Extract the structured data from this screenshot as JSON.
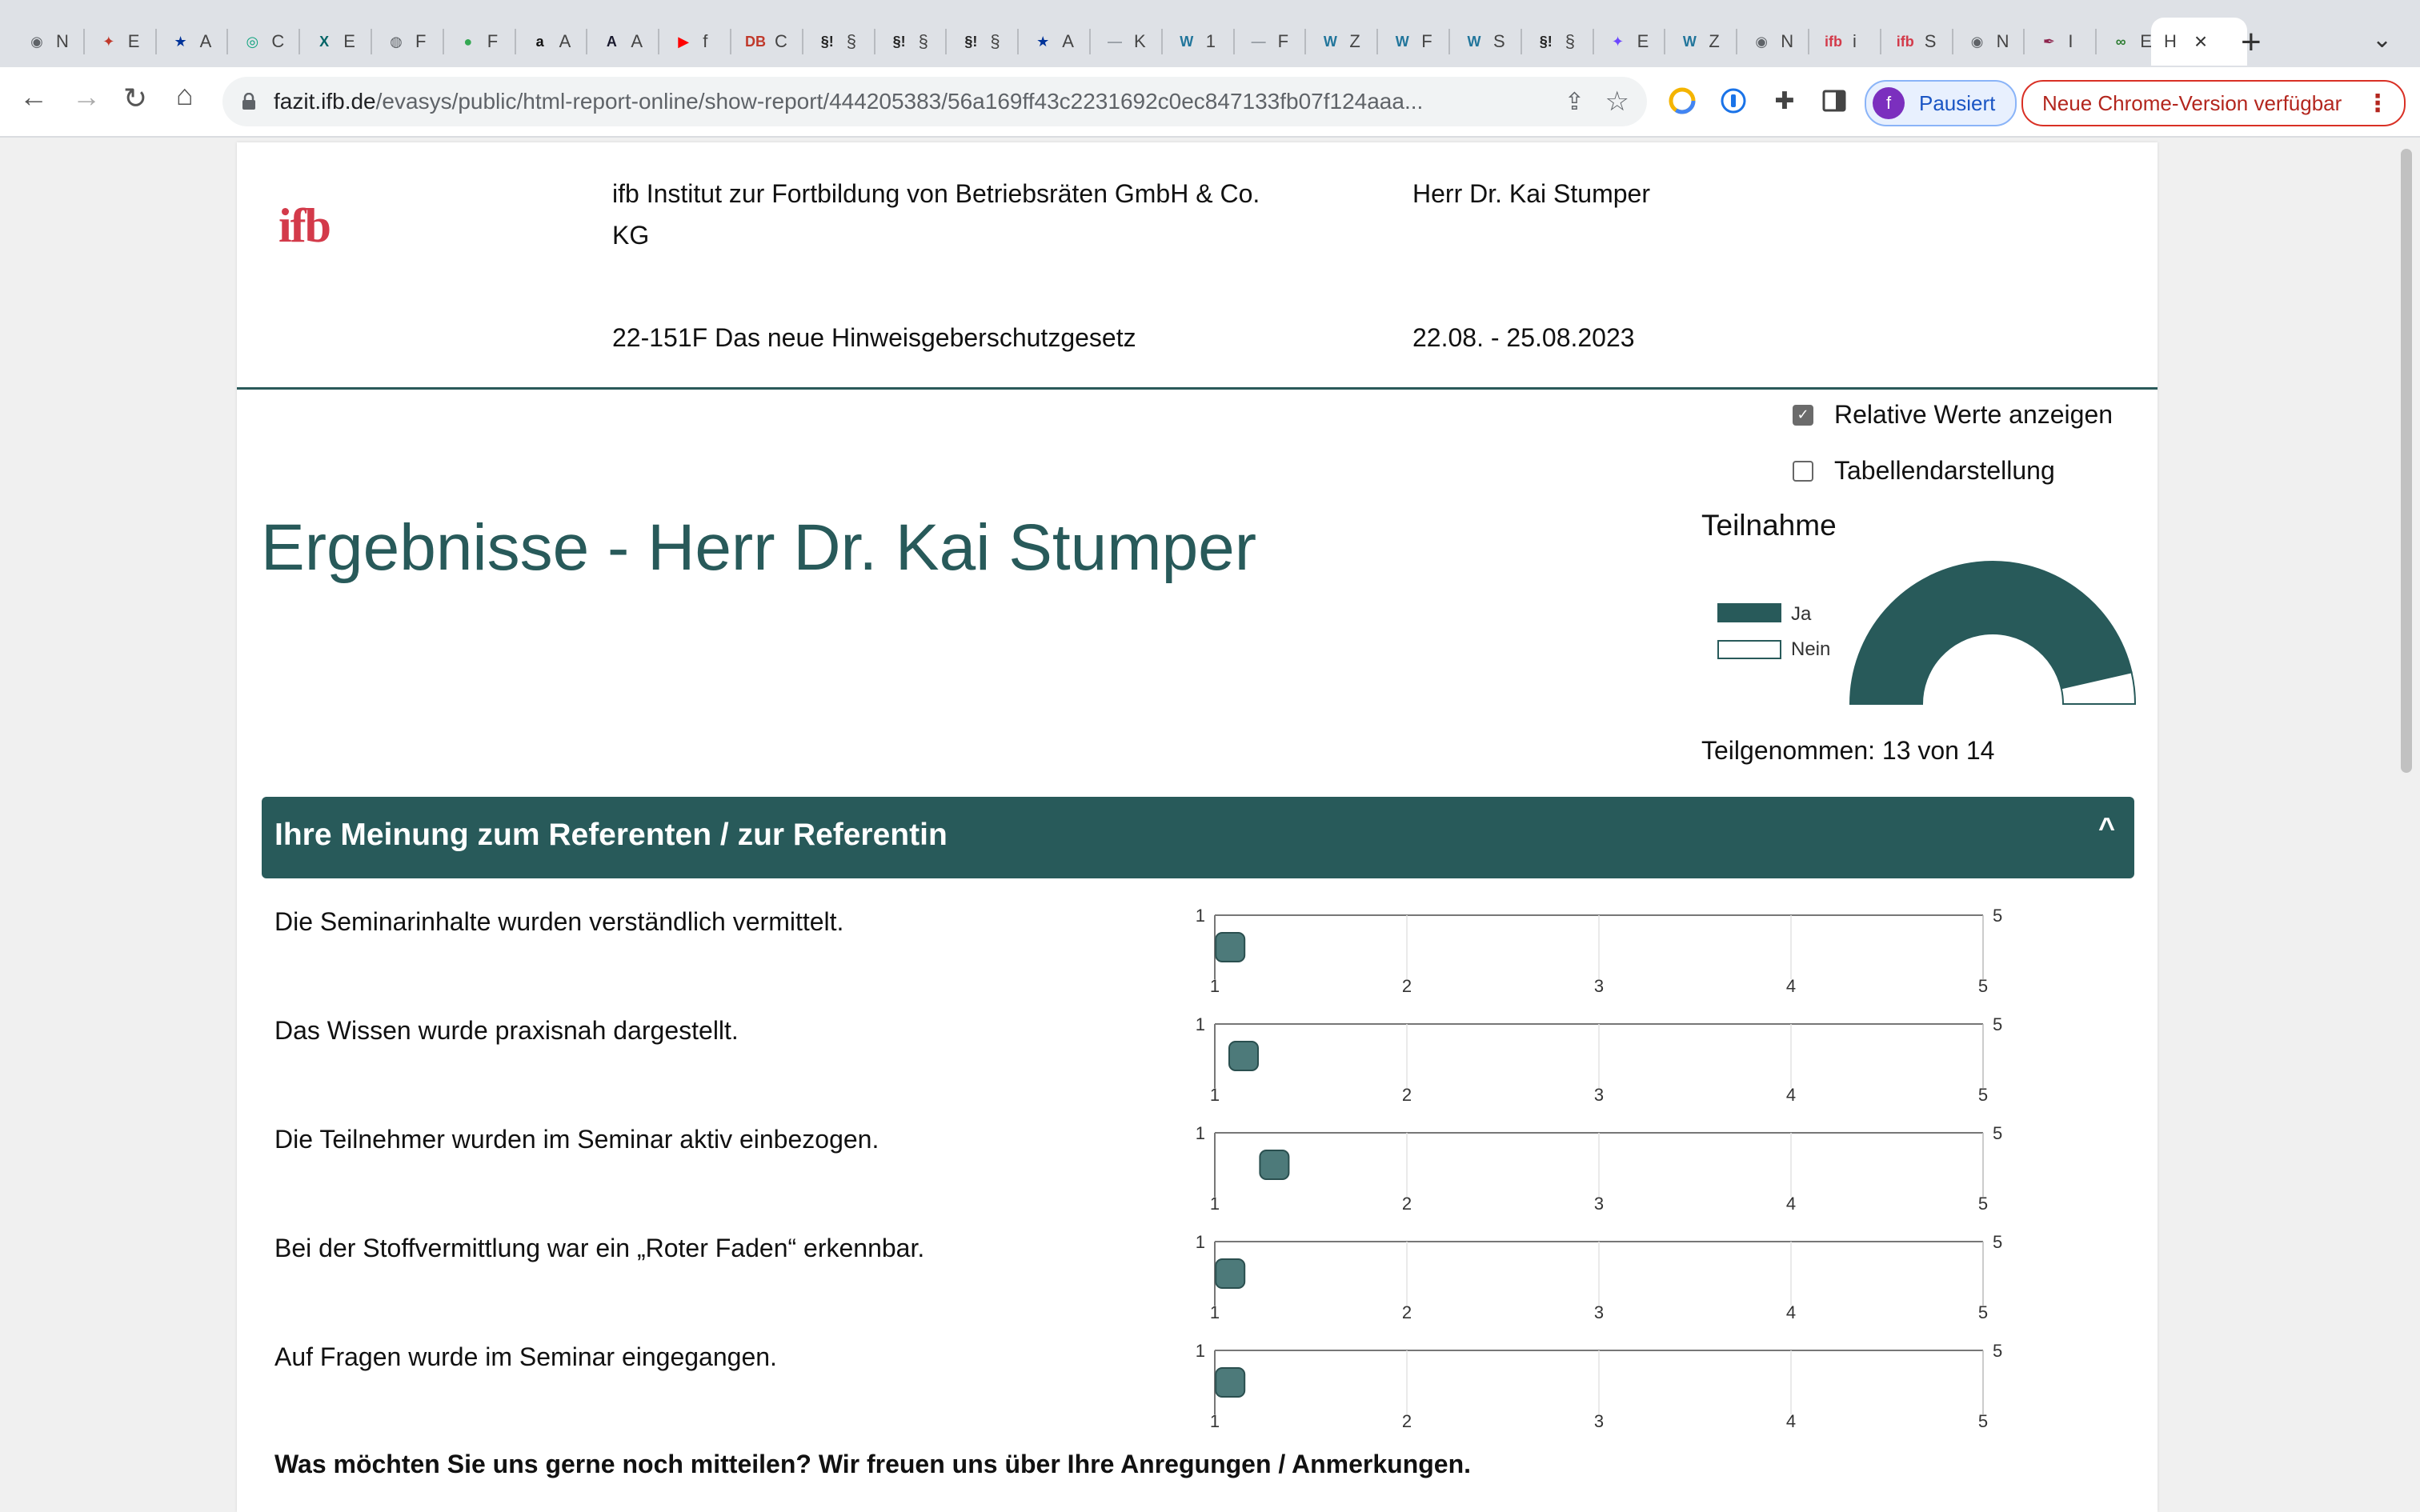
{
  "browser": {
    "tabs": [
      {
        "icon": "chrome-icon",
        "color": "#5f6368",
        "glyph": "◉",
        "label": "N"
      },
      {
        "icon": "bird-icon",
        "color": "#c0392b",
        "glyph": "✦",
        "label": "E"
      },
      {
        "icon": "eu-flag-icon",
        "color": "#003399",
        "glyph": "★",
        "label": "A"
      },
      {
        "icon": "openai-icon",
        "color": "#10a37f",
        "glyph": "◎",
        "label": "C"
      },
      {
        "icon": "xing-icon",
        "color": "#026466",
        "glyph": "X",
        "label": "E"
      },
      {
        "icon": "globe-icon",
        "color": "#5f6368",
        "glyph": "◍",
        "label": "F"
      },
      {
        "icon": "maps-pin-icon",
        "color": "#34a853",
        "glyph": "●",
        "label": "F"
      },
      {
        "icon": "amazon-icon",
        "color": "#111111",
        "glyph": "a",
        "label": "A"
      },
      {
        "icon": "adobe-icon",
        "color": "#1a1a2e",
        "glyph": "A",
        "label": "A"
      },
      {
        "icon": "youtube-icon",
        "color": "#ff0000",
        "glyph": "▶",
        "label": "f"
      },
      {
        "icon": "db-icon",
        "color": "#c0392b",
        "glyph": "DB",
        "label": "C"
      },
      {
        "icon": "paragraph-icon",
        "color": "#222222",
        "glyph": "§!",
        "label": "§"
      },
      {
        "icon": "paragraph-icon",
        "color": "#222222",
        "glyph": "§!",
        "label": "§"
      },
      {
        "icon": "paragraph-icon",
        "color": "#222222",
        "glyph": "§!",
        "label": "§"
      },
      {
        "icon": "eu-flag-icon",
        "color": "#003399",
        "glyph": "★",
        "label": "A"
      },
      {
        "icon": "globe-icon",
        "color": "#9aa0a6",
        "glyph": "—",
        "label": "K"
      },
      {
        "icon": "wordpress-icon",
        "color": "#21759b",
        "glyph": "W",
        "label": "1"
      },
      {
        "icon": "globe-icon",
        "color": "#9aa0a6",
        "glyph": "—",
        "label": "F"
      },
      {
        "icon": "wordpress-icon",
        "color": "#21759b",
        "glyph": "W",
        "label": "Z"
      },
      {
        "icon": "wordpress-icon",
        "color": "#21759b",
        "glyph": "W",
        "label": "F"
      },
      {
        "icon": "wordpress-icon",
        "color": "#21759b",
        "glyph": "W",
        "label": "S"
      },
      {
        "icon": "paragraph-icon",
        "color": "#222222",
        "glyph": "§!",
        "label": "§"
      },
      {
        "icon": "gemini-icon",
        "color": "#6c47ff",
        "glyph": "✦",
        "label": "E"
      },
      {
        "icon": "wordpress-icon",
        "color": "#21759b",
        "glyph": "W",
        "label": "Z"
      },
      {
        "icon": "chrome-icon",
        "color": "#5f6368",
        "glyph": "◉",
        "label": "N"
      },
      {
        "icon": "ifb-icon",
        "color": "#d33a4a",
        "glyph": "ifb",
        "label": "i"
      },
      {
        "icon": "ifb-icon",
        "color": "#d33a4a",
        "glyph": "ifb",
        "label": "S"
      },
      {
        "icon": "chrome-icon",
        "color": "#5f6368",
        "glyph": "◉",
        "label": "N"
      },
      {
        "icon": "feather-icon",
        "color": "#8e244d",
        "glyph": "✒",
        "label": "I"
      },
      {
        "icon": "link-icon",
        "color": "#2e7d32",
        "glyph": "∞",
        "label": "E"
      },
      {
        "icon": "",
        "color": "",
        "glyph": "",
        "label": "H"
      }
    ],
    "url_domain": "fazit.ifb.de",
    "url_path": "/evasys/public/html-report-online/show-report/444205383/56a169ff43c2231692c0ec847133fb07f124aaa...",
    "profile_initial": "f",
    "profile_label": "Pausiert",
    "update_label": "Neue Chrome-Version verfügbar"
  },
  "header": {
    "logo": "ifb",
    "institute_line1": "ifb Institut zur Fortbildung von Betriebsräten GmbH & Co.",
    "institute_line2": "KG",
    "speaker": "Herr Dr. Kai Stumper",
    "seminar": "22-151F Das neue Hinweisgeberschutzgesetz",
    "dates": "22.08. - 25.08.2023"
  },
  "options": {
    "relative_label": "Relative Werte anzeigen",
    "relative_checked": true,
    "table_label": "Tabellendarstellung",
    "table_checked": false
  },
  "page_title": "Ergebnisse - Herr Dr. Kai Stumper",
  "participation": {
    "title": "Teilnahme",
    "legend_yes": "Ja",
    "legend_no": "Nein",
    "count_text": "Teilgenommen: 13 von 14",
    "colors": {
      "yes": "#285a5a",
      "no": "#ffffff"
    }
  },
  "section": {
    "title": "Ihre Meinung zum Referenten / zur Referentin"
  },
  "questions": [
    {
      "label": "Die Seminarinhalte wurden verständlich vermittelt."
    },
    {
      "label": "Das Wissen wurde praxisnah dargestellt."
    },
    {
      "label": "Die Teilnehmer wurden im Seminar aktiv einbezogen."
    },
    {
      "label": "Bei der Stoffvermittlung war ein „Roter Faden“ erkennbar."
    },
    {
      "label": "Auf Fragen wurde im Seminar eingegangen."
    }
  ],
  "bottom_question": "Was möchten Sie uns gerne noch mitteilen? Wir freuen uns über Ihre Anregungen / Anmerkungen.",
  "chart_data": [
    {
      "type": "pie",
      "title": "Teilnahme",
      "categories": [
        "Ja",
        "Nein"
      ],
      "values": [
        13,
        1
      ],
      "colors": {
        "Ja": "#285a5a",
        "Nein": "#ffffff"
      }
    },
    {
      "type": "scatter",
      "title": "Die Seminarinhalte wurden verständlich vermittelt.",
      "xlim": [
        1,
        5
      ],
      "xticks": [
        "1",
        "2",
        "3",
        "4",
        "5"
      ],
      "left_label": "1",
      "right_label": "5",
      "values": [
        1.08
      ],
      "color": "#4d7a7a"
    },
    {
      "type": "scatter",
      "title": "Das Wissen wurde praxisnah dargestellt.",
      "xlim": [
        1,
        5
      ],
      "xticks": [
        "1",
        "2",
        "3",
        "4",
        "5"
      ],
      "left_label": "1",
      "right_label": "5",
      "values": [
        1.15
      ],
      "color": "#4d7a7a"
    },
    {
      "type": "scatter",
      "title": "Die Teilnehmer wurden im Seminar aktiv einbezogen.",
      "xlim": [
        1,
        5
      ],
      "xticks": [
        "1",
        "2",
        "3",
        "4",
        "5"
      ],
      "left_label": "1",
      "right_label": "5",
      "values": [
        1.31
      ],
      "color": "#4d7a7a"
    },
    {
      "type": "scatter",
      "title": "Bei der Stoffvermittlung war ein „Roter Faden“ erkennbar.",
      "xlim": [
        1,
        5
      ],
      "xticks": [
        "1",
        "2",
        "3",
        "4",
        "5"
      ],
      "left_label": "1",
      "right_label": "5",
      "values": [
        1.08
      ],
      "color": "#4d7a7a"
    },
    {
      "type": "scatter",
      "title": "Auf Fragen wurde im Seminar eingegangen.",
      "xlim": [
        1,
        5
      ],
      "xticks": [
        "1",
        "2",
        "3",
        "4",
        "5"
      ],
      "left_label": "1",
      "right_label": "5",
      "values": [
        1.08
      ],
      "color": "#4d7a7a"
    }
  ]
}
